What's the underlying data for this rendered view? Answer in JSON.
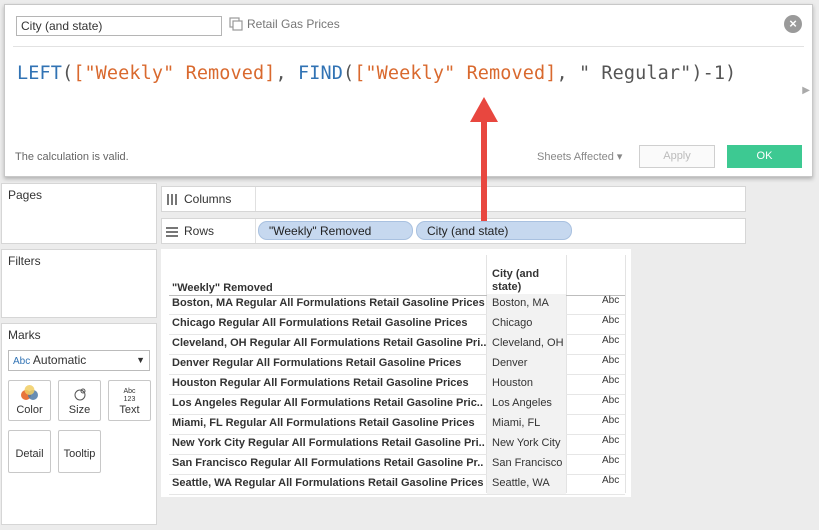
{
  "dialog": {
    "calc_name": "City (and state)",
    "datasource": "Retail Gas Prices",
    "formula": {
      "fn_left": "LEFT",
      "paren_open": "(",
      "field1": "[\"Weekly\" Removed]",
      "comma1": ", ",
      "fn_find": "FIND",
      "field2": "[\"Weekly\" Removed]",
      "rest": ", \" Regular\")-1)"
    },
    "status": "The calculation is valid.",
    "sheets_affected": "Sheets Affected",
    "apply_label": "Apply",
    "ok_label": "OK"
  },
  "cards": {
    "pages": "Pages",
    "filters": "Filters",
    "marks": "Marks",
    "mark_type": "Automatic",
    "mark_type_icon": "Abc",
    "buttons": {
      "color": "Color",
      "size": "Size",
      "text": "Text",
      "detail": "Detail",
      "tooltip": "Tooltip"
    }
  },
  "shelves": {
    "columns": "Columns",
    "rows": "Rows",
    "row_pills": [
      "\"Weekly\" Removed",
      "City (and state)"
    ]
  },
  "table": {
    "headers": [
      "\"Weekly\" Removed",
      "City (and state)"
    ],
    "rows": [
      {
        "removed": "Boston, MA Regular All Formulations Retail Gasoline Prices",
        "city": "Boston, MA",
        "mark": "Abc"
      },
      {
        "removed": "Chicago Regular All Formulations Retail Gasoline Prices",
        "city": "Chicago",
        "mark": "Abc"
      },
      {
        "removed": "Cleveland, OH Regular All Formulations Retail Gasoline Pri..",
        "city": "Cleveland, OH",
        "mark": "Abc"
      },
      {
        "removed": "Denver Regular All Formulations Retail Gasoline Prices",
        "city": "Denver",
        "mark": "Abc"
      },
      {
        "removed": "Houston Regular All Formulations Retail Gasoline Prices",
        "city": "Houston",
        "mark": "Abc"
      },
      {
        "removed": "Los Angeles Regular All Formulations Retail Gasoline Pric..",
        "city": "Los Angeles",
        "mark": "Abc"
      },
      {
        "removed": "Miami, FL Regular All Formulations Retail Gasoline Prices",
        "city": "Miami, FL",
        "mark": "Abc"
      },
      {
        "removed": "New York City Regular All Formulations Retail Gasoline Pri..",
        "city": "New York City",
        "mark": "Abc"
      },
      {
        "removed": "San Francisco Regular All Formulations Retail Gasoline Pr..",
        "city": "San Francisco",
        "mark": "Abc"
      },
      {
        "removed": "Seattle, WA Regular All Formulations Retail Gasoline Prices",
        "city": "Seattle, WA",
        "mark": "Abc"
      }
    ]
  },
  "colors": {
    "accent_ok": "#3dc992",
    "arrow": "#e8473f",
    "pill": "#c6d8ef",
    "function": "#3173b4",
    "field": "#d9692e"
  }
}
